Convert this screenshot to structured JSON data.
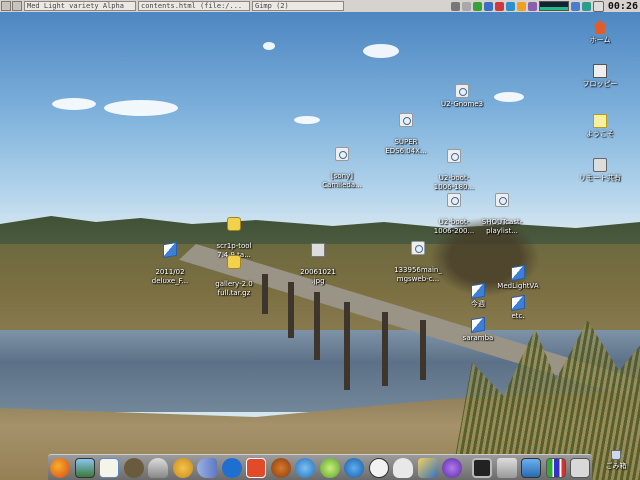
{
  "top_panel": {
    "tasks": [
      {
        "label": "Med Light variety Alpha"
      },
      {
        "label": "contents.html (file:/..."
      },
      {
        "label": "Gimp (2)"
      }
    ],
    "clock": "00:26"
  },
  "desktop_icons": [
    {
      "name": "home",
      "label": "ホーム"
    },
    {
      "name": "floppy",
      "label": "フロッピー"
    },
    {
      "name": "welcome",
      "label": "ようこそ"
    },
    {
      "name": "remote",
      "label": "リモート共有"
    },
    {
      "name": "trash",
      "label": "ごみ箱"
    },
    {
      "name": "file1",
      "label": "U2-Gnome3"
    },
    {
      "name": "file2",
      "label": "SUPER\nEDS6.04X..."
    },
    {
      "name": "file3",
      "label": "[sony]\nCamileda..."
    },
    {
      "name": "file4",
      "label": "U2-boot-\n1006-180..."
    },
    {
      "name": "file5",
      "label": "U2-boot-\n1006-200..."
    },
    {
      "name": "file6",
      "label": "SHOUTcast-\nplaylist..."
    },
    {
      "name": "file7",
      "label": "scr1p-tool\n7.4.9.ta..."
    },
    {
      "name": "file8",
      "label": "2011/02\ndeluxe_F..."
    },
    {
      "name": "file9",
      "label": "gallery-2.0\nfull.tar.gz"
    },
    {
      "name": "file10",
      "label": "20061021\n.jpg"
    },
    {
      "name": "file11",
      "label": "133956main_\nmgsweb-c..."
    },
    {
      "name": "file12",
      "label": "MedLightVA"
    },
    {
      "name": "file13",
      "label": "今週"
    },
    {
      "name": "file14",
      "label": "etc."
    },
    {
      "name": "file15",
      "label": "saramba"
    }
  ],
  "dock_icons": [
    "firefox-icon",
    "image-viewer-icon",
    "text-editor-icon",
    "gimp-icon",
    "thunderbird-icon",
    "paint-icon",
    "key-icon",
    "media-player-icon",
    "calendar-icon",
    "rhythmbox-icon",
    "settings-icon",
    "lime-icon",
    "compiz-icon",
    "writer-icon",
    "gnu-icon",
    "pen-icon",
    "nvu-icon",
    "terminal-icon",
    "disk-icon",
    "network-icon",
    "chart-icon",
    "system-icon"
  ],
  "colors": {
    "panel": "#d6d3ce",
    "dock": "#7f7f7f",
    "sky": "#7fb2dc"
  }
}
